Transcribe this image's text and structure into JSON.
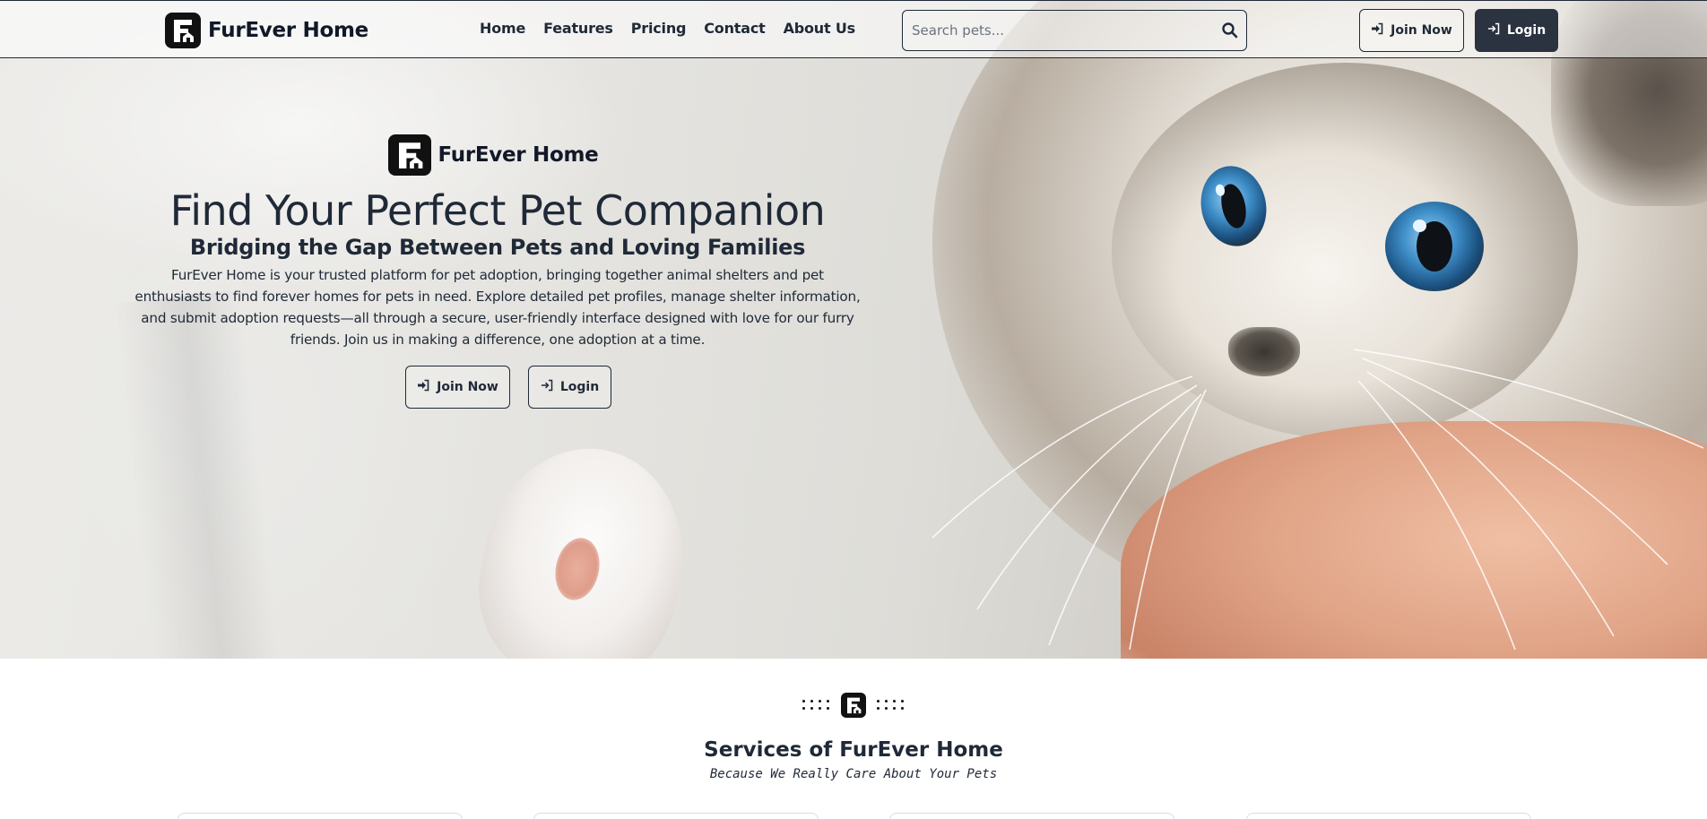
{
  "navbar": {
    "brand": "FurEver Home",
    "links": [
      "Home",
      "Features",
      "Pricing",
      "Contact",
      "About Us"
    ],
    "search_placeholder": "Search pets...",
    "join_label": "Join Now",
    "login_label": "Login"
  },
  "hero": {
    "brand": "FurEver Home",
    "title": "Find Your Perfect Pet Companion",
    "subtitle": "Bridging the Gap Between Pets and Loving Families",
    "description": "FurEver Home is your trusted platform for pet adoption, bringing together animal shelters and pet enthusiasts to find forever homes for pets in need. Explore detailed pet profiles, manage shelter information, and submit adoption requests—all through a secure, user-friendly interface designed with love for our furry friends. Join us in making a difference, one adoption at a time.",
    "join_label": "Join Now",
    "login_label": "Login"
  },
  "services": {
    "title": "Services of FurEver Home",
    "tagline": "Because We Really Care About Your Pets"
  },
  "colors": {
    "text": "#1f2937",
    "dark_button": "#2b3240",
    "logo": "#111111"
  },
  "icons": {
    "search": "search-icon",
    "join": "sign-in-arrow-icon",
    "login": "login-arrow-icon"
  }
}
